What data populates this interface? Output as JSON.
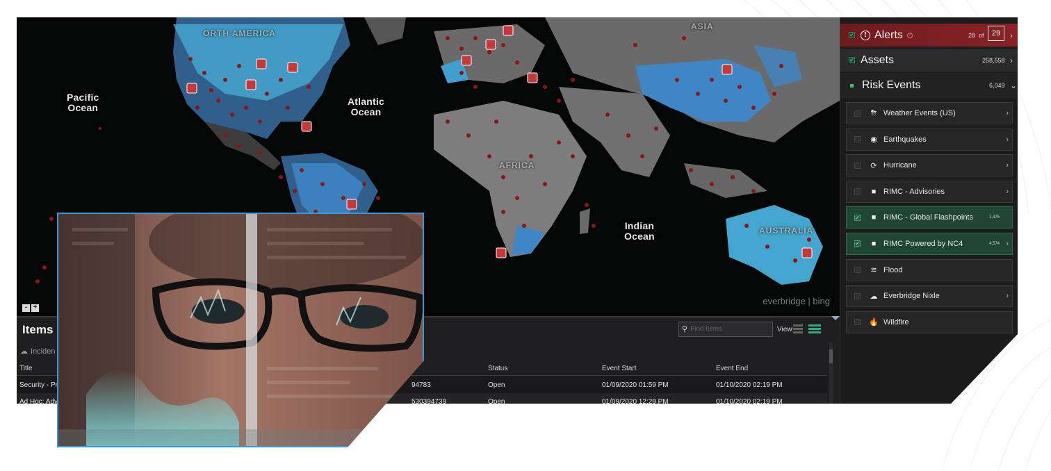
{
  "map": {
    "ocean_labels": {
      "pacific": "Pacific\nOcean",
      "atlantic": "Atlantic\nOcean",
      "indian": "Indian\nOcean"
    },
    "continent_labels": {
      "north_america": "ORTH AMERICA",
      "asia": "ASIA",
      "africa": "AFRICA",
      "australia": "AUSTRALIA"
    },
    "attribution": "everbridge | bing",
    "zoom_out": "-",
    "zoom_in": "+",
    "colors": {
      "land": "#8a8a8a",
      "highlight": "#3e86c6",
      "marker": "#7a1414",
      "ocean": "#050606"
    }
  },
  "items": {
    "title": "Items",
    "subtitle": "Inciden",
    "find_placeholder": "Find items",
    "view_label": "View:",
    "columns": {
      "title": "Title",
      "status": "Status",
      "event_start": "Event Start",
      "event_end": "Event End"
    },
    "rows": [
      {
        "title": "Security - Pro",
        "id": "94783",
        "status": "Open",
        "event_start": "01/09/2020   01:59 PM",
        "event_end": "01/10/2020   02:19 PM"
      },
      {
        "title": "Ad Hoc: Advis",
        "id": "530394739",
        "status": "Open",
        "event_start": "01/09/2020   12:29 PM",
        "event_end": "01/10/2020   02:19 PM"
      }
    ]
  },
  "panel": {
    "alerts": {
      "label": "Alerts",
      "count": "28",
      "of": "of",
      "total": "29"
    },
    "assets": {
      "label": "Assets",
      "count": "258,558"
    },
    "risk_events": {
      "label": "Risk Events",
      "count": "6,049"
    },
    "risk_items": [
      {
        "label": "Weather Events (US)",
        "icon": "weather-icon",
        "glyph": "⛈",
        "checked": false,
        "count": "",
        "chevron": "›"
      },
      {
        "label": "Earthquakes",
        "icon": "earthquake-icon",
        "glyph": "◉",
        "checked": false,
        "count": "",
        "chevron": "›"
      },
      {
        "label": "Hurricane",
        "icon": "hurricane-icon",
        "glyph": "⟳",
        "checked": false,
        "count": "",
        "chevron": "›"
      },
      {
        "label": "RIMC - Advisories",
        "icon": "rimc-icon",
        "glyph": "■",
        "checked": false,
        "count": "",
        "chevron": "›"
      },
      {
        "label": "RIMC - Global Flashpoints",
        "icon": "rimc-icon",
        "glyph": "■",
        "checked": true,
        "count": "1,475",
        "chevron": ""
      },
      {
        "label": "RIMC Powered by NC4",
        "icon": "rimc-icon",
        "glyph": "■",
        "checked": true,
        "count": "4,574",
        "chevron": "›"
      },
      {
        "label": "Flood",
        "icon": "flood-icon",
        "glyph": "≋",
        "checked": false,
        "count": "",
        "chevron": ""
      },
      {
        "label": "Everbridge Nixle",
        "icon": "nixle-icon",
        "glyph": "☁",
        "checked": false,
        "count": "",
        "chevron": "›"
      },
      {
        "label": "Wildfire",
        "icon": "wildfire-icon",
        "glyph": "🔥",
        "checked": false,
        "count": "",
        "chevron": ""
      }
    ]
  }
}
